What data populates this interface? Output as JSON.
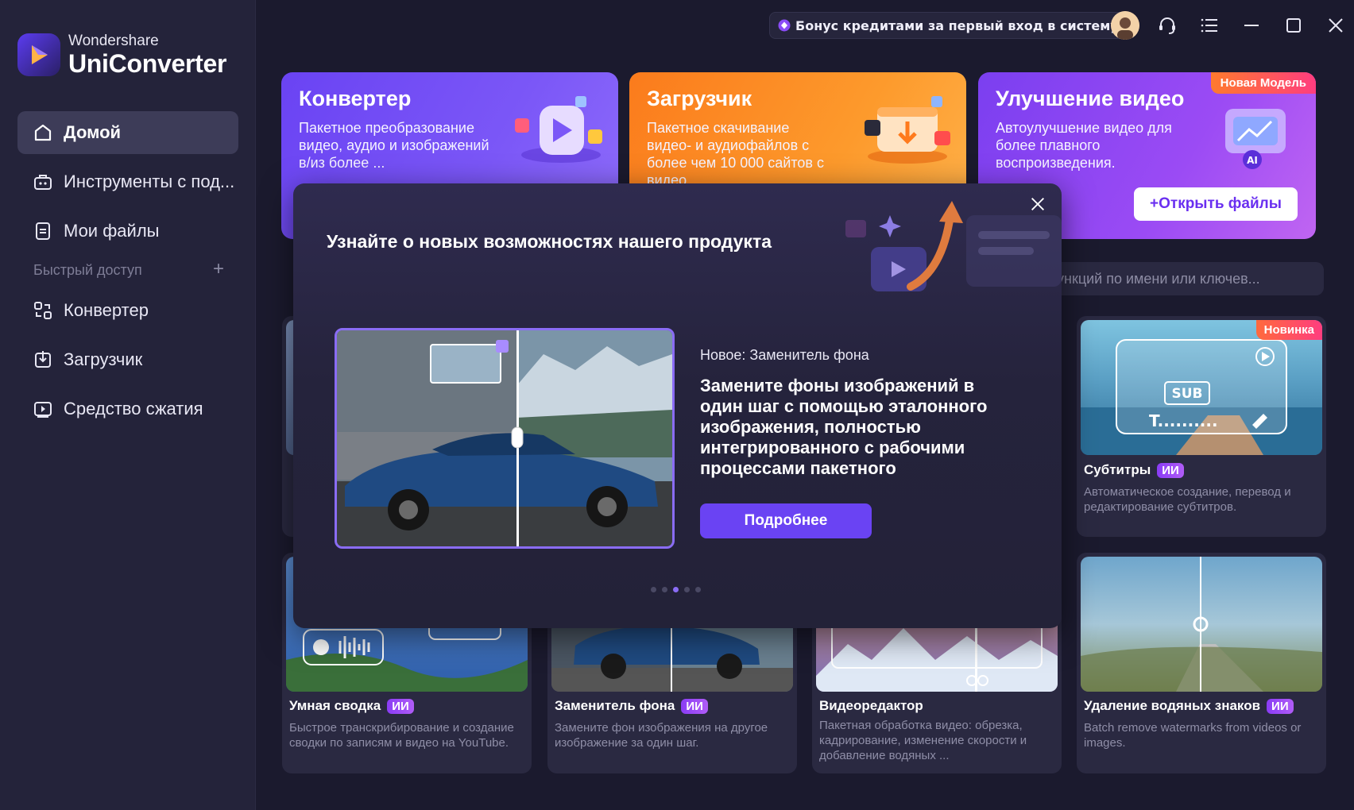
{
  "app": {
    "brand": "Wondershare",
    "product": "UniConverter"
  },
  "sidebar": {
    "items": [
      {
        "label": "Домой",
        "icon": "home-icon",
        "active": true
      },
      {
        "label": "Инструменты с под...",
        "icon": "toolbox-icon"
      },
      {
        "label": "Мои файлы",
        "icon": "file-icon"
      }
    ],
    "quick_access_label": "Быстрый доступ",
    "quick_add": "+",
    "quick_items": [
      {
        "label": "Конвертер",
        "icon": "converter-icon"
      },
      {
        "label": "Загрузчик",
        "icon": "download-icon"
      },
      {
        "label": "Средство сжатия",
        "icon": "compress-icon"
      }
    ]
  },
  "topbar": {
    "bonus": "Бонус кредитами за первый вход в систему"
  },
  "features": [
    {
      "title": "Конвертер",
      "desc": "Пакетное преобразование видео, аудио и изображений в/из более ..."
    },
    {
      "title": "Загрузчик",
      "desc": "Пакетное скачивание видео- и аудиофайлов с более чем 10 000 сайтов с видео"
    },
    {
      "title": "Улучшение видео",
      "desc": "Автоулучшение видео для более плавного воспроизведения.",
      "badge": "Новая Модель",
      "button": "+Открыть файлы"
    }
  ],
  "search": {
    "placeholder": "ункций по имени или ключев..."
  },
  "tools": [
    {
      "title": "Субтитры",
      "ai": "ИИ",
      "desc": "Автоматическое создание, перевод и редактирование субтитров.",
      "badge": "Новинка"
    },
    {
      "title": "Умная сводка",
      "ai": "ИИ",
      "desc": "Быстрое транскрибирование и создание сводки по записям и видео на YouTube."
    },
    {
      "title": "Заменитель фона",
      "ai": "ИИ",
      "desc": "Замените фон изображения на другое изображение за один шаг."
    },
    {
      "title": "Видеоредактор",
      "desc": "Пакетная обработка видео: обрезка, кадрирование, изменение скорости и добавление водяных ..."
    },
    {
      "title": "Удаление водяных знаков",
      "ai": "ИИ",
      "desc": "Batch remove watermarks from videos or images."
    }
  ],
  "modal": {
    "title": "Узнайте о новых возможностях нашего продукта",
    "slide_sub": "Новое: Заменитель фона",
    "slide_main": "Замените фоны изображений в один шаг с помощью эталонного изображения, полностью интегрированного с рабочими процессами пакетного",
    "button": "Подробнее",
    "dots": 5,
    "active_dot": 2
  }
}
